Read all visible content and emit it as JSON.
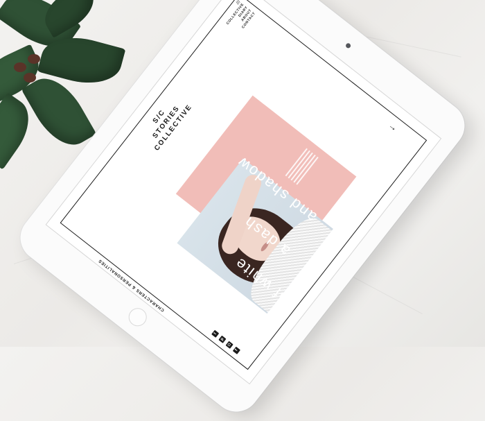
{
  "logo": {
    "line1": "S/C",
    "line2": "STORIES",
    "line3": "COLLECTIVE"
  },
  "nav": {
    "divider": "///",
    "items": [
      "COLLECTIVE",
      "DIARY",
      "ABOUT",
      "CONTACT"
    ]
  },
  "side_label": "CHARACTERS & PERSONALITIES",
  "hero": {
    "line1": "a dash",
    "line2": "and shadow",
    "line3": "of white"
  },
  "arrow": "→",
  "social": [
    "f",
    "◘",
    "p",
    "t"
  ],
  "colors": {
    "accent_pink": "#f1bdb8",
    "ink": "#1b1b1b",
    "plant": "#2f5135"
  },
  "icons": [
    "facebook-icon",
    "instagram-icon",
    "pinterest-icon",
    "twitter-icon",
    "arrow-down-icon"
  ]
}
